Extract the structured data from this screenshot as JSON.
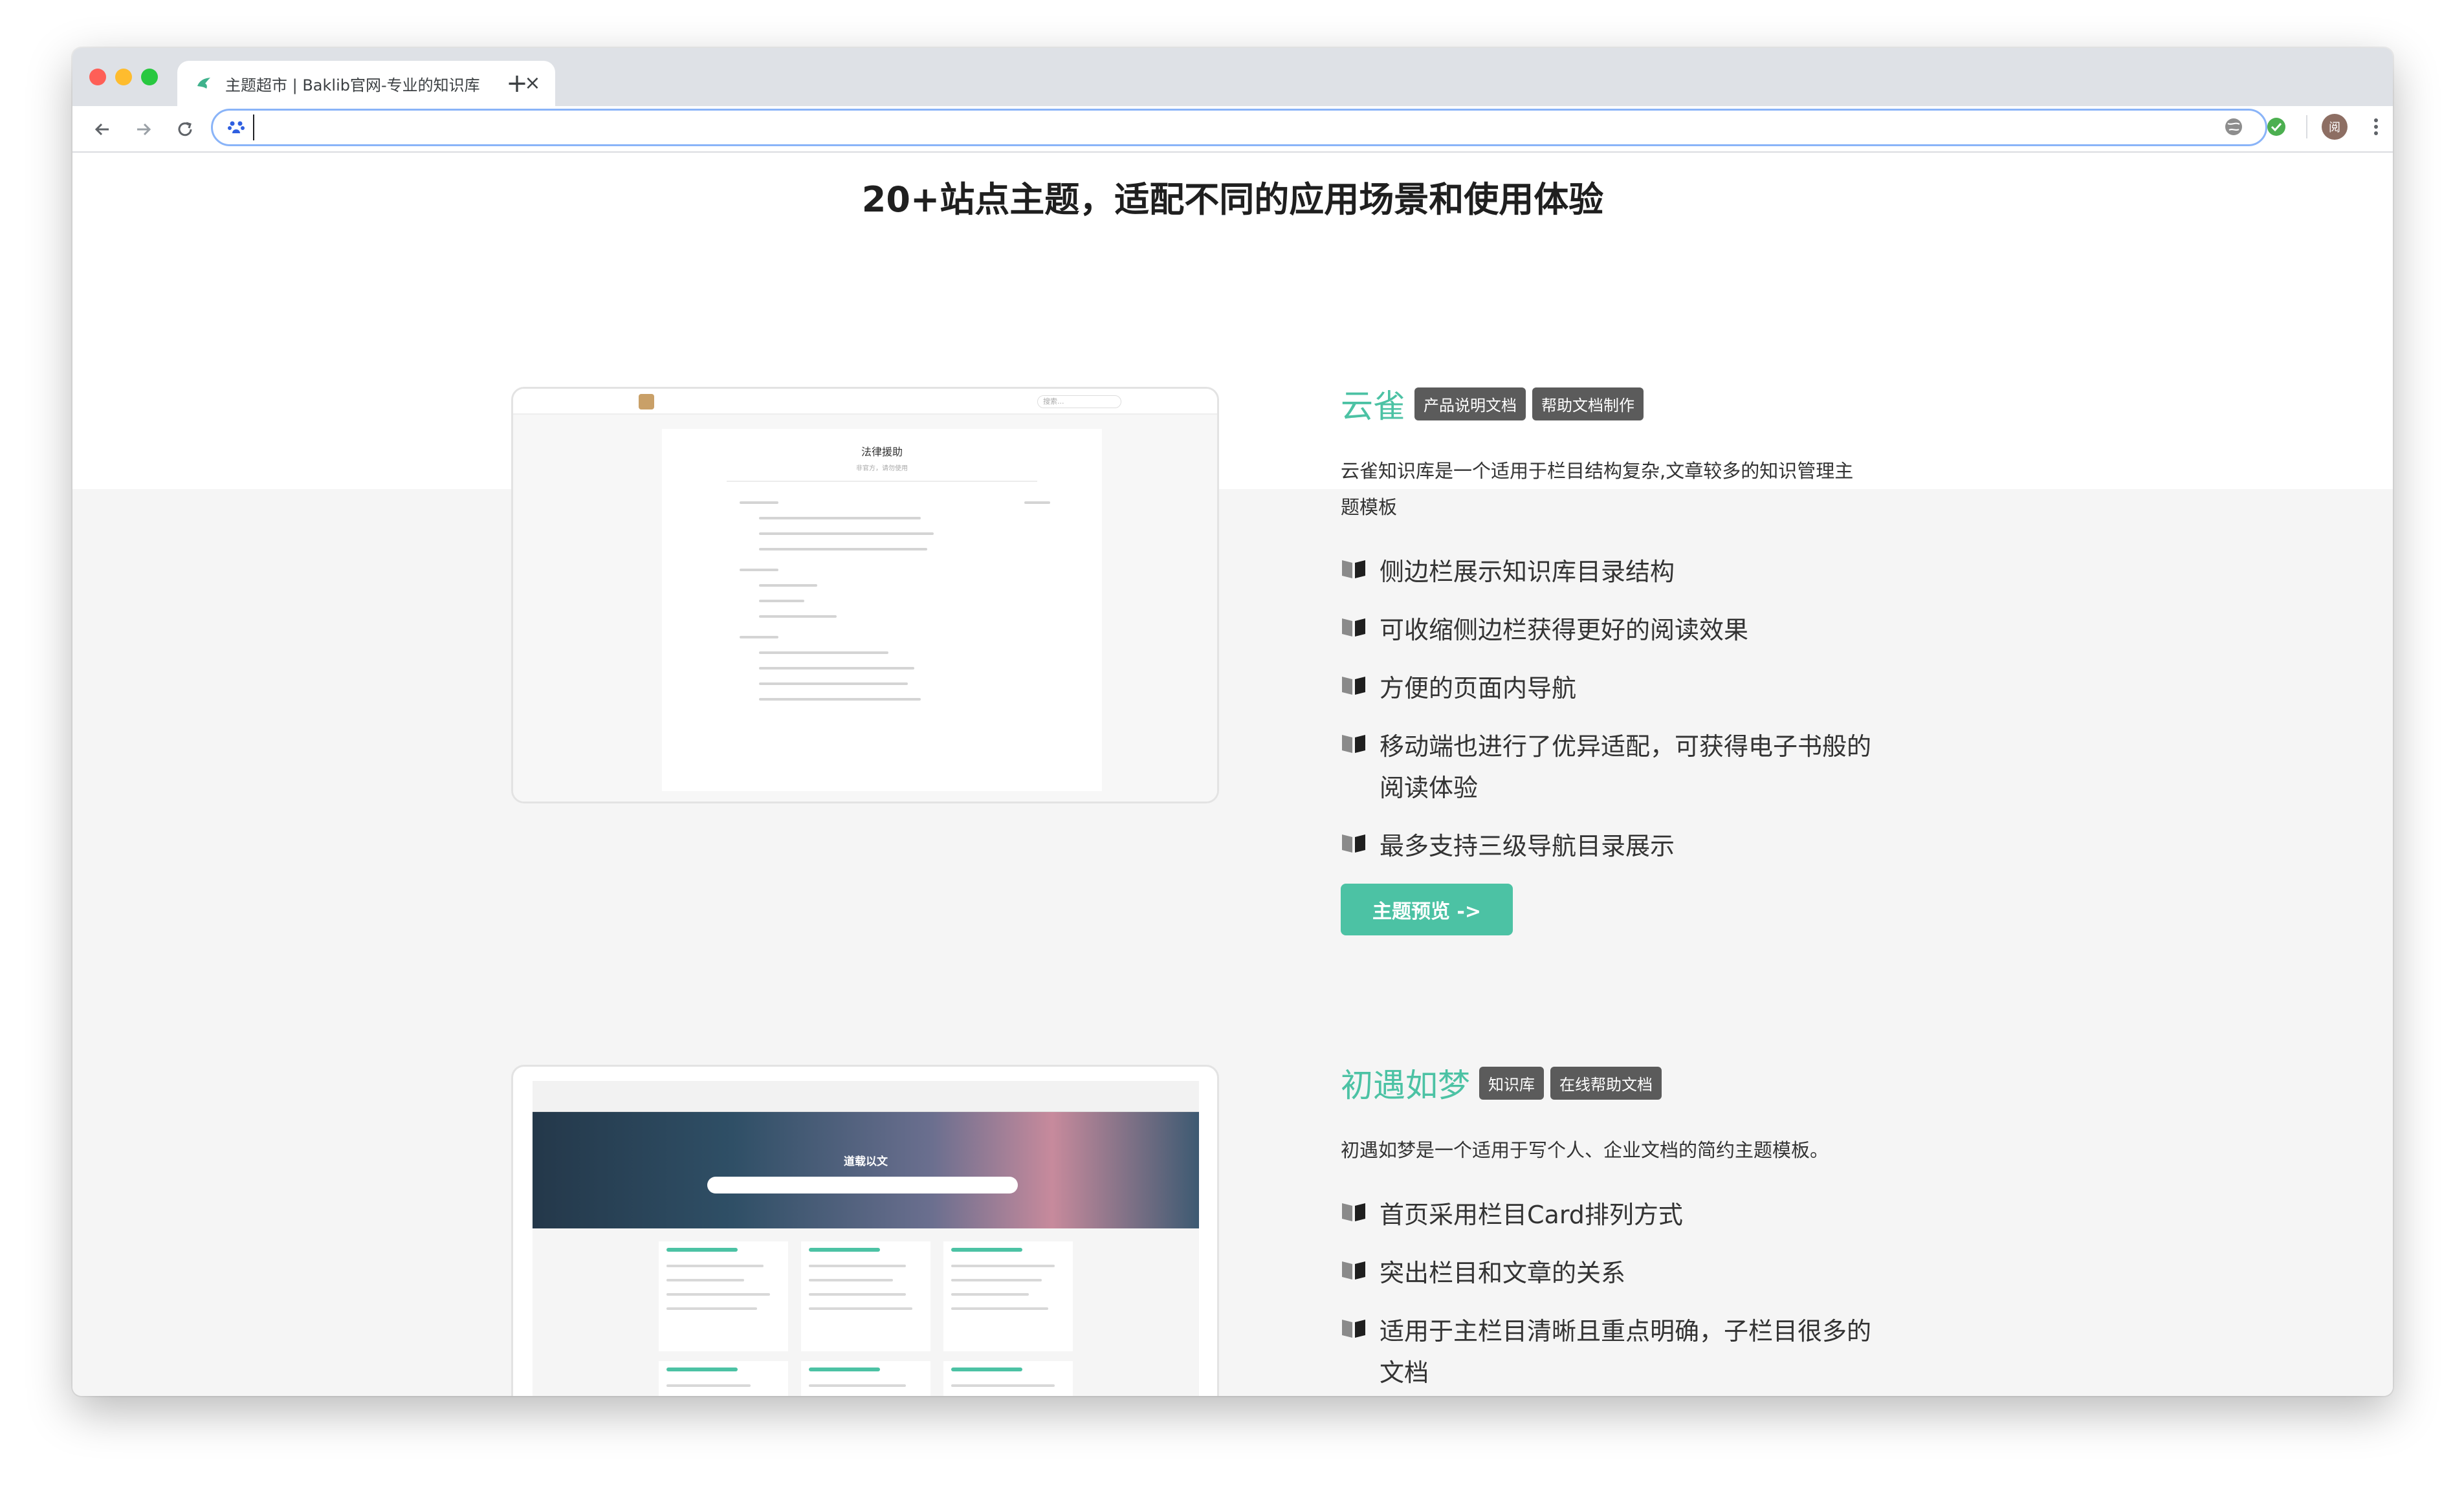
{
  "browser": {
    "tab_title": "主题超市 | Baklib官网-专业的知识库",
    "tab_close": "×",
    "new_tab": "+",
    "address_value": "",
    "profile_initial": "阅"
  },
  "page": {
    "heading": "20+站点主题，适配不同的应用场景和使用体验",
    "themes": [
      {
        "name": "云雀",
        "tags": [
          "产品说明文档",
          "帮助文档制作"
        ],
        "description": "云雀知识库是一个适用于栏目结构复杂,文章较多的知识管理主题模板",
        "features": [
          "侧边栏展示知识库目录结构",
          "可收缩侧边栏获得更好的阅读效果",
          "方便的页面内导航",
          "移动端也进行了优异适配，可获得电子书般的阅读体验",
          "最多支持三级导航目录展示"
        ],
        "button": "主题预览  ->",
        "preview": {
          "doc_title": "法律援助",
          "doc_subtitle": "非官方，请勿使用",
          "search_placeholder": "搜索..."
        }
      },
      {
        "name": "初遇如梦",
        "tags": [
          "知识库",
          "在线帮助文档"
        ],
        "description": "初遇如梦是一个适用于写个人、企业文档的简约主题模板。",
        "features": [
          "首页采用栏目Card排列方式",
          "突出栏目和文章的关系",
          "适用于主栏目清晰且重点明确，子栏目很多的文档"
        ],
        "preview": {
          "hero_title": "道载以文"
        }
      }
    ]
  },
  "colors": {
    "accent": "#4cc2a4",
    "tag_bg": "#5b5b5b"
  }
}
